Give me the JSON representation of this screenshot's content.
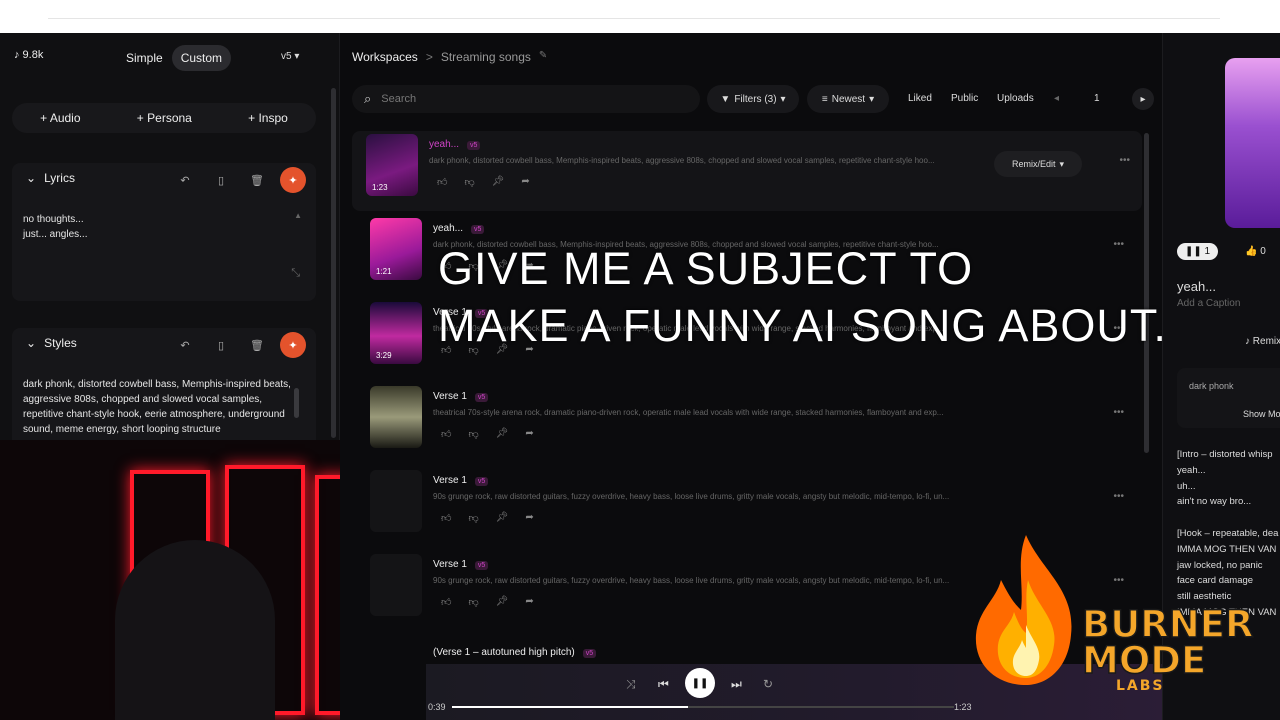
{
  "topbar": {},
  "sidebar": {
    "credits": "♪ 9.8k",
    "mode_simple": "Simple",
    "mode_custom": "Custom",
    "version": "v5",
    "add_audio": "+  Audio",
    "add_persona": "+  Persona",
    "add_inspo": "+  Inspo",
    "lyrics_label": "Lyrics",
    "lyrics_text_1": "no thoughts...",
    "lyrics_text_2": "just... angles...",
    "styles_label": "Styles",
    "styles_text": "dark phonk, distorted cowbell bass, Memphis-inspired beats, aggressive 808s, chopped and slowed vocal samples, repetitive chant-style hook, eerie atmosphere, underground sound, meme energy, short looping structure"
  },
  "header": {
    "workspaces": "Workspaces",
    "separator": ">",
    "workspace_name": "Streaming songs",
    "search_placeholder": "Search",
    "filters": "Filters (3)",
    "sort": "Newest",
    "liked": "Liked",
    "public": "Public",
    "uploads": "Uploads",
    "page": "1"
  },
  "songs": [
    {
      "title": "yeah...",
      "badge": "v5",
      "duration": "1:23",
      "desc": "dark phonk, distorted cowbell bass, Memphis-inspired beats, aggressive 808s, chopped and slowed vocal samples, repetitive chant-style hoo...",
      "remix": "Remix/Edit"
    },
    {
      "title": "yeah...",
      "badge": "v5",
      "duration": "1:21",
      "desc": "dark phonk, distorted cowbell bass, Memphis-inspired beats, aggressive 808s, chopped and slowed vocal samples, repetitive chant-style hoo..."
    },
    {
      "title": "Verse 1",
      "badge": "v5",
      "duration": "3:29",
      "desc": "theatrical 70s-style arena rock, dramatic piano-driven rock, operatic male lead vocals with wide range, stacked harmonies, flamboyant and exp..."
    },
    {
      "title": "Verse 1",
      "badge": "v5",
      "duration": "",
      "desc": "theatrical 70s-style arena rock, dramatic piano-driven rock, operatic male lead vocals with wide range, stacked harmonies, flamboyant and exp..."
    },
    {
      "title": "Verse 1",
      "badge": "v5",
      "duration": "",
      "desc": "90s grunge rock, raw distorted guitars, fuzzy overdrive, heavy bass, loose live drums, gritty male vocals, angsty but melodic, mid-tempo, lo-fi, un..."
    },
    {
      "title": "Verse 1",
      "badge": "v5",
      "duration": "",
      "desc": "90s grunge rock, raw distorted guitars, fuzzy overdrive, heavy bass, loose live drums, gritty male vocals, angsty but melodic, mid-tempo, lo-fi, un..."
    },
    {
      "title": "(Verse 1 – autotuned high pitch)",
      "badge": "v5",
      "duration": "",
      "desc": ""
    }
  ],
  "overlay": {
    "line1": "GIVE ME A SUBJECT TO",
    "line2": "MAKE A FUNNY AI SONG ABOUT."
  },
  "player": {
    "elapsed": "0:39",
    "total": "1:23",
    "progress_fraction": 0.47
  },
  "right_panel": {
    "play_count": "1",
    "likes": "0",
    "title": "yeah...",
    "caption": "Add a Caption",
    "remix": "Remix",
    "style_tag": "dark phonk",
    "show_more": "Show More",
    "lyrics": [
      "[Intro – distorted whisp",
      "yeah...",
      "uh...",
      "ain't no way bro...",
      "",
      "[Hook – repeatable, dea",
      "IMMA MOG THEN VAN",
      "jaw locked, no panic",
      "face card damage",
      "still aesthetic",
      "IMMA MOG THEN VAN"
    ]
  },
  "logo": {
    "line1": "BURNER",
    "line2": "MODE",
    "line3": "LABS"
  },
  "colors": {
    "accent_orange": "#e4532c",
    "badge_pink": "#d044c8",
    "neon_red": "#ff1a2a"
  }
}
